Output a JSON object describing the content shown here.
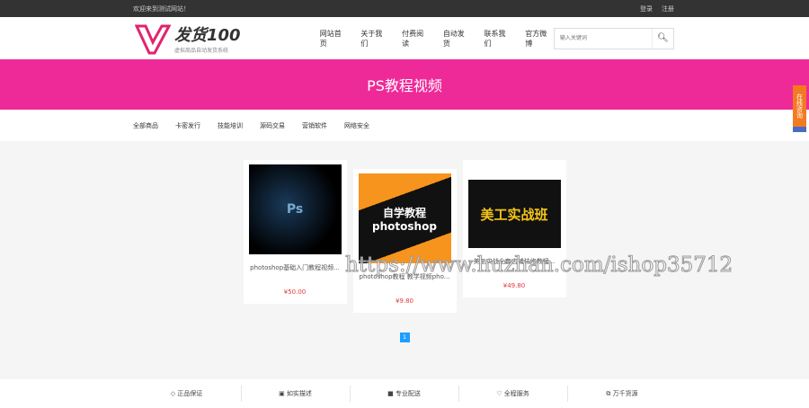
{
  "topbar": {
    "welcome": "欢迎来到测试网站！",
    "login": "登录",
    "register": "注册"
  },
  "logo": {
    "name": "发货100",
    "tagline": "虚拟商品自动发货系统"
  },
  "nav": [
    "网站首页",
    "关于我们",
    "付费阅读",
    "自动发货",
    "联系我们",
    "官方微博"
  ],
  "search": {
    "placeholder": "输入关键词"
  },
  "banner": {
    "title": "PS教程视频"
  },
  "categories": [
    "全部商品",
    "卡密发行",
    "技能培训",
    "源码交易",
    "营销软件",
    "网络安全"
  ],
  "products": [
    {
      "title": "photoshop基础入门教程视频...",
      "price": "¥50.00",
      "img_text": "Ps"
    },
    {
      "title": "photoshop教程 教学视频pho...",
      "price": "¥9.80",
      "img_text": "自学教程 photoshop"
    },
    {
      "title": "美工实战全套店铺装修教程...",
      "price": "¥49.80",
      "img_text": "美工实战班"
    }
  ],
  "pagination": {
    "current": "1"
  },
  "footer": [
    "正品保证",
    "如实描述",
    "专业配送",
    "全程服务",
    "万千货源"
  ],
  "side_tab": "在线咨询",
  "watermark": "https://www.huzhan.com/ishop35712"
}
